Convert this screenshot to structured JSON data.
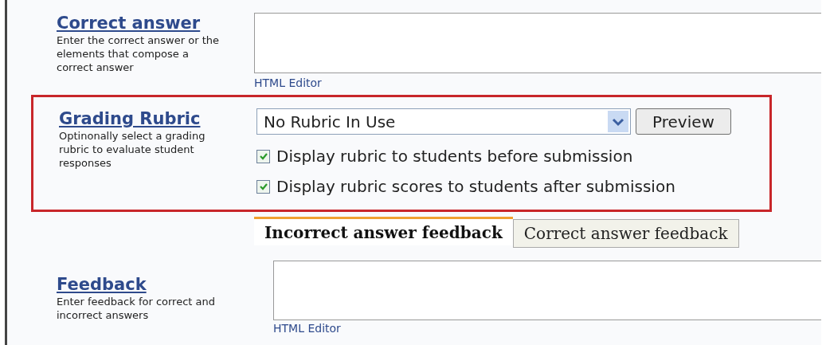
{
  "sections": [
    {
      "kind": "answer",
      "title": "Correct answer",
      "description": "Enter the correct answer or the elements that compose a correct answer",
      "editor_link": "HTML Editor"
    },
    {
      "kind": "rubric",
      "title": "Grading Rubric",
      "description": "Optinonally select a grading rubric to evaluate student responses",
      "highlighted": true,
      "select_value": "No Rubric In Use",
      "button": "Preview",
      "options": [
        {
          "label": "Display rubric to students before submission",
          "checked": true
        },
        {
          "label": "Display rubric scores to students after submission",
          "checked": true
        }
      ]
    },
    {
      "kind": "feedback",
      "title": "Feedback",
      "description": "Enter feedback for correct and incorrect answers",
      "tabs": [
        {
          "label": "Incorrect answer feedback",
          "selected": true
        },
        {
          "label": "Correct answer feedback",
          "selected": false
        }
      ],
      "editor_link": "HTML Editor"
    }
  ]
}
